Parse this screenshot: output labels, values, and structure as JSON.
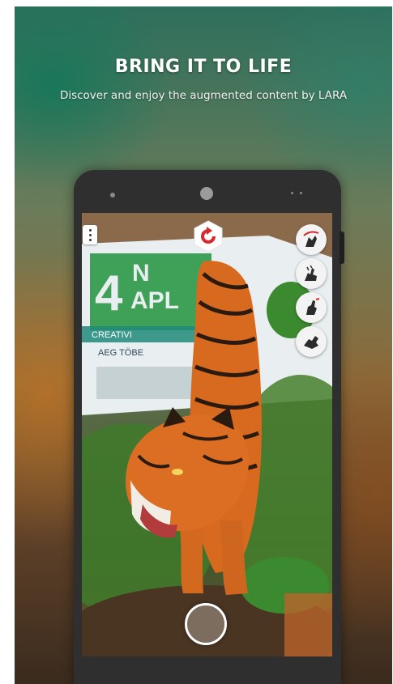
{
  "header": {
    "title": "BRING IT TO LIFE",
    "subtitle": "Discover and enjoy the augmented content by LARA"
  },
  "scene": {
    "magazine_text_large": "4",
    "magazine_text_n": "N",
    "magazine_text_apl": "APL",
    "magazine_text_creative": "CREATIVI",
    "magazine_text_name": "AEG TÖBE"
  },
  "ar_controls": {
    "menu_icon": "overflow-menu-icon",
    "reset_icon": "reset-rotate-icon",
    "gesture_icons": [
      "rotate-gesture-icon",
      "pinch-gesture-icon",
      "drag-gesture-icon",
      "swipe-gesture-icon"
    ],
    "shutter_icon": "camera-shutter-icon"
  },
  "colors": {
    "accent": "#d9272e",
    "tiger_orange": "#d86a1f",
    "foliage_green": "#3f7a2a"
  }
}
